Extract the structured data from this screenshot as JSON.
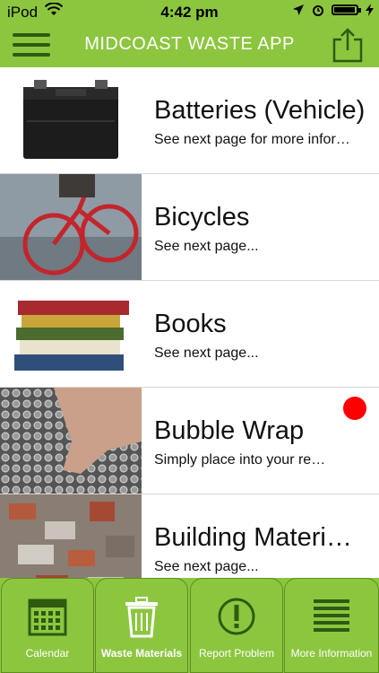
{
  "status": {
    "carrier": "iPod",
    "time": "4:42 pm",
    "battery_level": 0.95
  },
  "header": {
    "title": "MIDCOAST WASTE APP",
    "menu_icon": "hamburger-menu-icon",
    "share_icon": "share-icon"
  },
  "items": [
    {
      "title": "Batteries (Vehicle)",
      "subtitle": "See next page for more infor…",
      "image": "car-battery"
    },
    {
      "title": "Bicycles",
      "subtitle": "See next page...",
      "image": "bicycle"
    },
    {
      "title": "Books",
      "subtitle": "See next page...",
      "image": "stack-of-books"
    },
    {
      "title": "Bubble Wrap",
      "subtitle": "Simply place into your re…",
      "image": "bubble-wrap",
      "badge": true
    },
    {
      "title": "Building Materi…",
      "subtitle": "See next page...",
      "image": "rubble"
    }
  ],
  "tabs": [
    {
      "label": "Calendar",
      "icon": "calendar-icon"
    },
    {
      "label": "Waste Materials",
      "icon": "trash-bin-icon",
      "active": true
    },
    {
      "label": "Report Problem",
      "icon": "exclamation-icon"
    },
    {
      "label": "More Information",
      "icon": "list-icon"
    }
  ],
  "colors": {
    "bar_green": "#8cc63f",
    "dark_green": "#2e5a12",
    "badge_red": "#ff0000"
  }
}
